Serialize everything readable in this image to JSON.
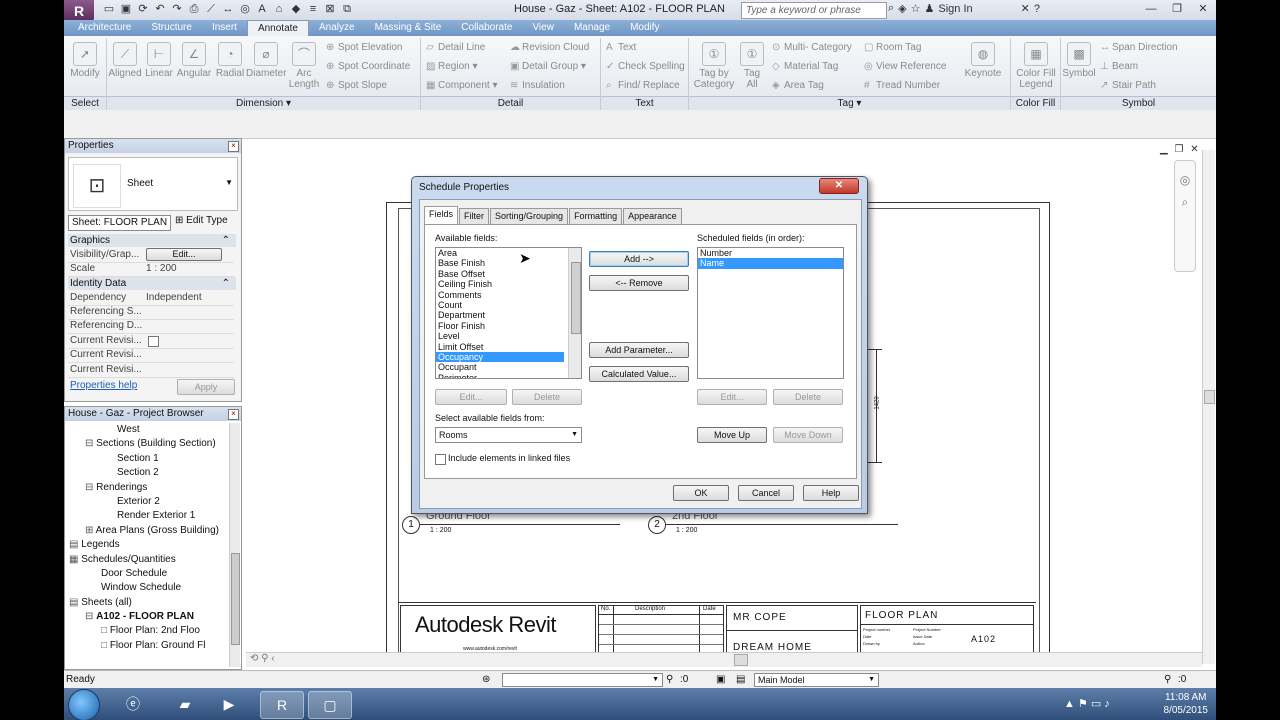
{
  "window": {
    "app_button": "R",
    "title": "House - Gaz - Sheet: A102 - FLOOR PLAN",
    "search_placeholder": "Type a keyword or phrase",
    "sign_in": "Sign In"
  },
  "ribbon_tabs": [
    "Architecture",
    "Structure",
    "Insert",
    "Annotate",
    "Analyze",
    "Massing & Site",
    "Collaborate",
    "View",
    "Manage",
    "Modify"
  ],
  "ribbon": {
    "select": {
      "modify": "Modify",
      "panel": "Select"
    },
    "dimension": {
      "aligned": "Aligned",
      "linear": "Linear",
      "angular": "Angular",
      "radial": "Radial",
      "diameter": "Diameter",
      "arc_length_1": "Arc",
      "arc_length_2": "Length",
      "spot_elevation": "Spot Elevation",
      "spot_coordinate": "Spot Coordinate",
      "spot_slope": "Spot Slope",
      "panel": "Dimension ▾"
    },
    "detail": {
      "detail_line": "Detail Line",
      "region": "Region ▾",
      "component": "Component ▾",
      "revision_cloud": "Revision Cloud",
      "detail_group": "Detail Group ▾",
      "insulation": "Insulation",
      "panel": "Detail"
    },
    "text": {
      "text": "Text",
      "check_spelling": "Check Spelling",
      "find_replace": "Find/ Replace",
      "panel": "Text"
    },
    "tag": {
      "tag_by_category_1": "Tag by",
      "tag_by_category_2": "Category",
      "tag_all_1": "Tag",
      "tag_all_2": "All",
      "multi_category": "Multi- Category",
      "material_tag": "Material Tag",
      "area_tag": "Area Tag",
      "room_tag": "Room Tag",
      "view_reference": "View Reference",
      "tread_number": "Tread Number",
      "keynote": "Keynote",
      "panel": "Tag ▾"
    },
    "color_fill": {
      "legend_1": "Color Fill",
      "legend_2": "Legend",
      "panel": "Color Fill"
    },
    "symbol": {
      "symbol": "Symbol",
      "span_direction": "Span Direction",
      "beam": "Beam",
      "stair_path": "Stair Path",
      "panel": "Symbol"
    }
  },
  "properties": {
    "title": "Properties",
    "type_name": "Sheet",
    "selector": "Sheet: FLOOR PLAN",
    "edit_type": "Edit Type",
    "groups": {
      "graphics": "Graphics",
      "identity": "Identity Data"
    },
    "rows": [
      {
        "k": "Visibility/Grap...",
        "v": "Edit..."
      },
      {
        "k": "Scale",
        "v": "1 : 200"
      },
      {
        "k": "Dependency",
        "v": "Independent"
      },
      {
        "k": "Referencing S...",
        "v": ""
      },
      {
        "k": "Referencing D...",
        "v": ""
      },
      {
        "k": "Current Revisi...",
        "v": ""
      },
      {
        "k": "Current Revisi...",
        "v": ""
      },
      {
        "k": "Current Revisi...",
        "v": ""
      }
    ],
    "help": "Properties help",
    "apply": "Apply"
  },
  "browser": {
    "title": "House - Gaz - Project Browser",
    "items": [
      {
        "label": "West",
        "indent": 3,
        "icon": ""
      },
      {
        "label": "Sections (Building Section)",
        "indent": 1,
        "icon": "⊟"
      },
      {
        "label": "Section 1",
        "indent": 3,
        "icon": ""
      },
      {
        "label": "Section 2",
        "indent": 3,
        "icon": ""
      },
      {
        "label": "Renderings",
        "indent": 1,
        "icon": "⊟"
      },
      {
        "label": "Exterior 2",
        "indent": 3,
        "icon": ""
      },
      {
        "label": "Render Exterior 1",
        "indent": 3,
        "icon": ""
      },
      {
        "label": "Area Plans (Gross Building)",
        "indent": 1,
        "icon": "⊞"
      },
      {
        "label": "Legends",
        "indent": 0,
        "icon": "▤"
      },
      {
        "label": "Schedules/Quantities",
        "indent": 0,
        "icon": "▦"
      },
      {
        "label": "Door Schedule",
        "indent": 2,
        "icon": ""
      },
      {
        "label": "Window Schedule",
        "indent": 2,
        "icon": ""
      },
      {
        "label": "Sheets (all)",
        "indent": 0,
        "icon": "▤"
      },
      {
        "label": "A102 - FLOOR PLAN",
        "indent": 1,
        "icon": "⊟"
      },
      {
        "label": "Floor Plan: 2nd Floo",
        "indent": 2,
        "icon": "□"
      },
      {
        "label": "Floor Plan: Ground Fl",
        "indent": 2,
        "icon": "□"
      }
    ]
  },
  "drawing": {
    "view1_num": "1",
    "view1_name": "Ground Floor",
    "view1_scale": "1 : 200",
    "view2_num": "2",
    "view2_name": "2nd Floor",
    "view2_scale": "1 : 200",
    "dim_text": "1420",
    "logo": "Autodesk Revit",
    "logo_url": "www.autodesk.com/revit",
    "rev_headers": [
      "No.",
      "Description",
      "Date"
    ],
    "owner": "MR COPE",
    "project": "DREAM HOME",
    "sheet_name": "FLOOR PLAN",
    "sheet_number": "A102",
    "tb_labels": [
      "Project number",
      "Date",
      "Drawn by"
    ],
    "tb_values": [
      "Project Number",
      "Issue Date",
      "Author"
    ]
  },
  "dialog": {
    "title": "Schedule Properties",
    "tabs": [
      "Fields",
      "Filter",
      "Sorting/Grouping",
      "Formatting",
      "Appearance"
    ],
    "available_label": "Available fields:",
    "available": [
      "Area",
      "Base Finish",
      "Base Offset",
      "Ceiling Finish",
      "Comments",
      "Count",
      "Department",
      "Floor Finish",
      "Level",
      "Limit Offset",
      "Occupancy",
      "Occupant",
      "Perimeter"
    ],
    "available_selected": "Occupancy",
    "scheduled_label": "Scheduled fields (in order):",
    "scheduled": [
      "Number",
      "Name"
    ],
    "scheduled_selected": "Name",
    "add": "Add -->",
    "remove": "<-- Remove",
    "add_parameter": "Add Parameter...",
    "calculated_value": "Calculated Value...",
    "edit": "Edit...",
    "delete": "Delete",
    "select_from_label": "Select available fields from:",
    "select_from_value": "Rooms",
    "include_linked": "Include elements in linked files",
    "move_up": "Move Up",
    "move_down": "Move Down",
    "ok": "OK",
    "cancel": "Cancel",
    "help": "Help"
  },
  "status": {
    "text": "Ready",
    "filter_count": ":0",
    "model": "Main Model",
    "select_count": ":0"
  },
  "taskbar": {
    "time": "11:08 AM",
    "date": "8/05/2015"
  }
}
